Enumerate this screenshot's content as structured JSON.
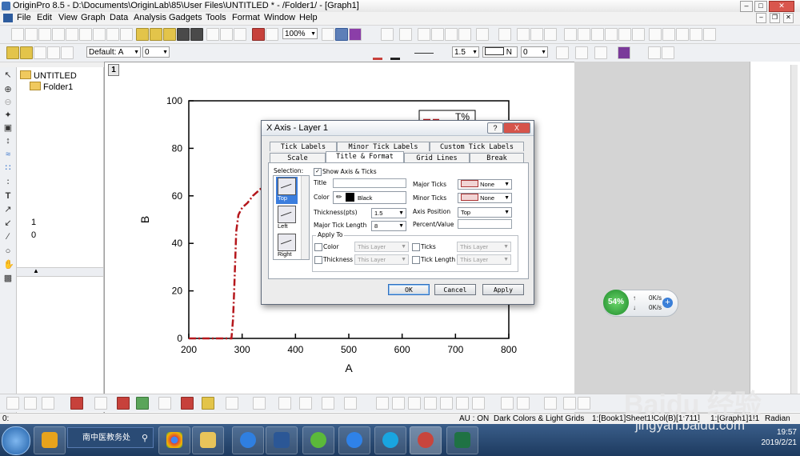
{
  "window": {
    "title": "OriginPro 8.5 - D:\\Documents\\OriginLab\\85\\User Files\\UNTITLED * - /Folder1/ - [Graph1]",
    "min": "0",
    "max": "1",
    "close": "r"
  },
  "menu": [
    "File",
    "Edit",
    "View",
    "Graph",
    "Data",
    "Analysis",
    "Gadgets",
    "Tools",
    "Format",
    "Window",
    "Help"
  ],
  "toolbar": {
    "zoom": "100%",
    "font": "Default: A",
    "font_size": "0",
    "line_size": "1.5",
    "fill_pattern": "N",
    "offset": "0"
  },
  "project": {
    "root": "UNTITLED",
    "folder": "Folder1",
    "list": [
      "1",
      "0"
    ]
  },
  "graph": {
    "layer": "1",
    "legend_partial": "T%"
  },
  "chart_data": {
    "type": "line",
    "xlabel": "A",
    "ylabel": "B",
    "xlim": [
      200,
      800
    ],
    "ylim": [
      0,
      100
    ],
    "xticks": [
      "200",
      "300",
      "400",
      "500",
      "600",
      "700",
      "800"
    ],
    "yticks": [
      "0",
      "20",
      "40",
      "60",
      "80",
      "100"
    ],
    "line_style": "dash-dot",
    "line_color": "#b5171c",
    "series": [
      {
        "name": "T%",
        "x": [
          200,
          270,
          280,
          283,
          285,
          289,
          293,
          300,
          310,
          320,
          330,
          340
        ],
        "y": [
          0,
          0,
          0,
          8,
          20,
          45,
          52,
          55,
          57,
          60,
          62,
          64
        ]
      }
    ]
  },
  "dialog": {
    "title": "X Axis - Layer 1",
    "help": "?",
    "close": "X",
    "tabs_row1": [
      "Tick Labels",
      "Minor Tick Labels",
      "Custom Tick Labels"
    ],
    "tabs_row2": [
      "Scale",
      "Title & Format",
      "Grid Lines",
      "Break"
    ],
    "selection_label": "Selection:",
    "selection": [
      "Top",
      "Left",
      "Right"
    ],
    "show_axis": "Show Axis & Ticks",
    "title_label": "Title",
    "color_label": "Color",
    "color_value": "Black",
    "thickness_label": "Thickness(pts)",
    "thickness_value": "1.5",
    "major_len_label": "Major Tick Length",
    "major_len_value": "8",
    "major_ticks_label": "Major Ticks",
    "major_ticks_value": "None",
    "minor_ticks_label": "Minor Ticks",
    "minor_ticks_value": "None",
    "axis_pos_label": "Axis Position",
    "axis_pos_value": "Top",
    "percent_label": "Percent/Value",
    "apply_to": "Apply To",
    "apply_color": "Color",
    "apply_thickness": "Thickness",
    "apply_ticks": "Ticks",
    "apply_tick_length": "Tick Length",
    "this_layer": "This Layer",
    "ok": "OK",
    "cancel": "Cancel",
    "apply": "Apply"
  },
  "net": {
    "percent": "54%",
    "up": "0K/s",
    "down": "0K/s"
  },
  "status": {
    "left": "0:",
    "au": "AU : ON",
    "theme": "Dark Colors & Light Grids",
    "book": "1:[Book1]Sheet1!Col(B)[1:711]",
    "graph": "1:[Graph1]1!1",
    "units": "Radian"
  },
  "taskbar": {
    "search": "南中医教务处",
    "time": "19:57",
    "date": "2019/2/21"
  },
  "watermark": {
    "logo": "Baidu 经验",
    "url": "jingyan.baidu.com"
  }
}
